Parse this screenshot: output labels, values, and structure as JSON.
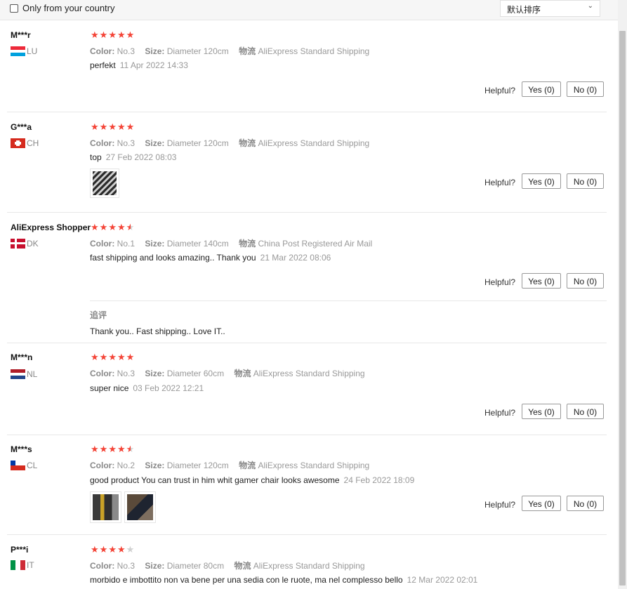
{
  "filter": {
    "only_country_label": "Only from your country"
  },
  "sort": {
    "selected": "默认排序"
  },
  "labels": {
    "color": "Color:",
    "size": "Size:",
    "shipping": "物流",
    "helpful": "Helpful?",
    "followup": "追评"
  },
  "reviews": [
    {
      "name": "M***r",
      "country": "LU",
      "rating": 5,
      "color": "No.3",
      "size": "Diameter 120cm",
      "shipping": "AliExpress Standard Shipping",
      "text": "perfekt",
      "date": "11 Apr 2022 14:33",
      "yes": "Yes (0)",
      "no": "No (0)"
    },
    {
      "name": "G***a",
      "country": "CH",
      "rating": 5,
      "color": "No.3",
      "size": "Diameter 120cm",
      "shipping": "AliExpress Standard Shipping",
      "text": "top",
      "date": "27 Feb 2022 08:03",
      "yes": "Yes (0)",
      "no": "No (0)"
    },
    {
      "name": "AliExpress Shopper",
      "country": "DK",
      "rating": 4.5,
      "color": "No.1",
      "size": "Diameter 140cm",
      "shipping": "China Post Registered Air Mail",
      "text": "fast shipping and looks amazing.. Thank you",
      "date": "21 Mar 2022 08:06",
      "yes": "Yes (0)",
      "no": "No (0)",
      "followup": "Thank you.. Fast shipping.. Love IT.."
    },
    {
      "name": "M***n",
      "country": "NL",
      "rating": 5,
      "color": "No.3",
      "size": "Diameter 60cm",
      "shipping": "AliExpress Standard Shipping",
      "text": "super nice",
      "date": "03 Feb 2022 12:21",
      "yes": "Yes (0)",
      "no": "No (0)"
    },
    {
      "name": "M***s",
      "country": "CL",
      "rating": 4.5,
      "color": "No.2",
      "size": "Diameter 120cm",
      "shipping": "AliExpress Standard Shipping",
      "text": "good product You can trust in him whit gamer chair looks awesome",
      "date": "24 Feb 2022 18:09",
      "yes": "Yes (0)",
      "no": "No (0)"
    },
    {
      "name": "P***i",
      "country": "IT",
      "rating": 4,
      "color": "No.3",
      "size": "Diameter 80cm",
      "shipping": "AliExpress Standard Shipping",
      "text": "morbido e imbottito non va bene per una sedia con le ruote, ma nel complesso bello",
      "date": "12 Mar 2022 02:01"
    }
  ],
  "colors": {
    "star": "#f44336",
    "star_empty": "#d0d0d0"
  }
}
